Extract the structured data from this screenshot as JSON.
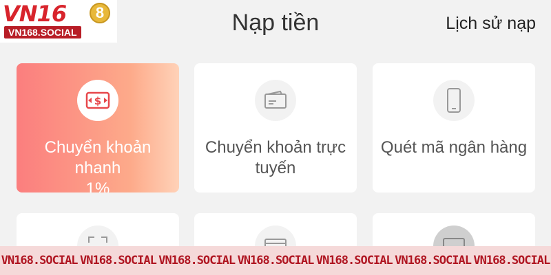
{
  "brand": {
    "logo_text": "VN16",
    "logo_ring": "8",
    "logo_sub": "VN168.SOCIAL"
  },
  "header": {
    "title": "Nạp tiền",
    "history_link": "Lịch sử nạp"
  },
  "methods": [
    {
      "label_lines": [
        "Chuyển khoản",
        "nhanh",
        "1%"
      ],
      "icon": "money-transfer-icon",
      "active": true
    },
    {
      "label_lines": [
        "Chuyển khoản trực",
        "tuyến"
      ],
      "icon": "wallet-icon",
      "active": false
    },
    {
      "label_lines": [
        "Quét mã ngân hàng"
      ],
      "icon": "phone-icon",
      "active": false
    },
    {
      "label_lines": [],
      "icon": "scan-icon",
      "active": false
    },
    {
      "label_lines": [],
      "icon": "card-icon",
      "active": false
    },
    {
      "label_lines": [],
      "icon": "screen-icon",
      "active": false
    }
  ],
  "watermark": {
    "text": "VN168.SOCIAL"
  },
  "colors": {
    "active_start": "#fb7e7e",
    "active_end": "#ffd2b8",
    "brand_red": "#d8242c",
    "banner_bg": "#f5d9d9"
  }
}
